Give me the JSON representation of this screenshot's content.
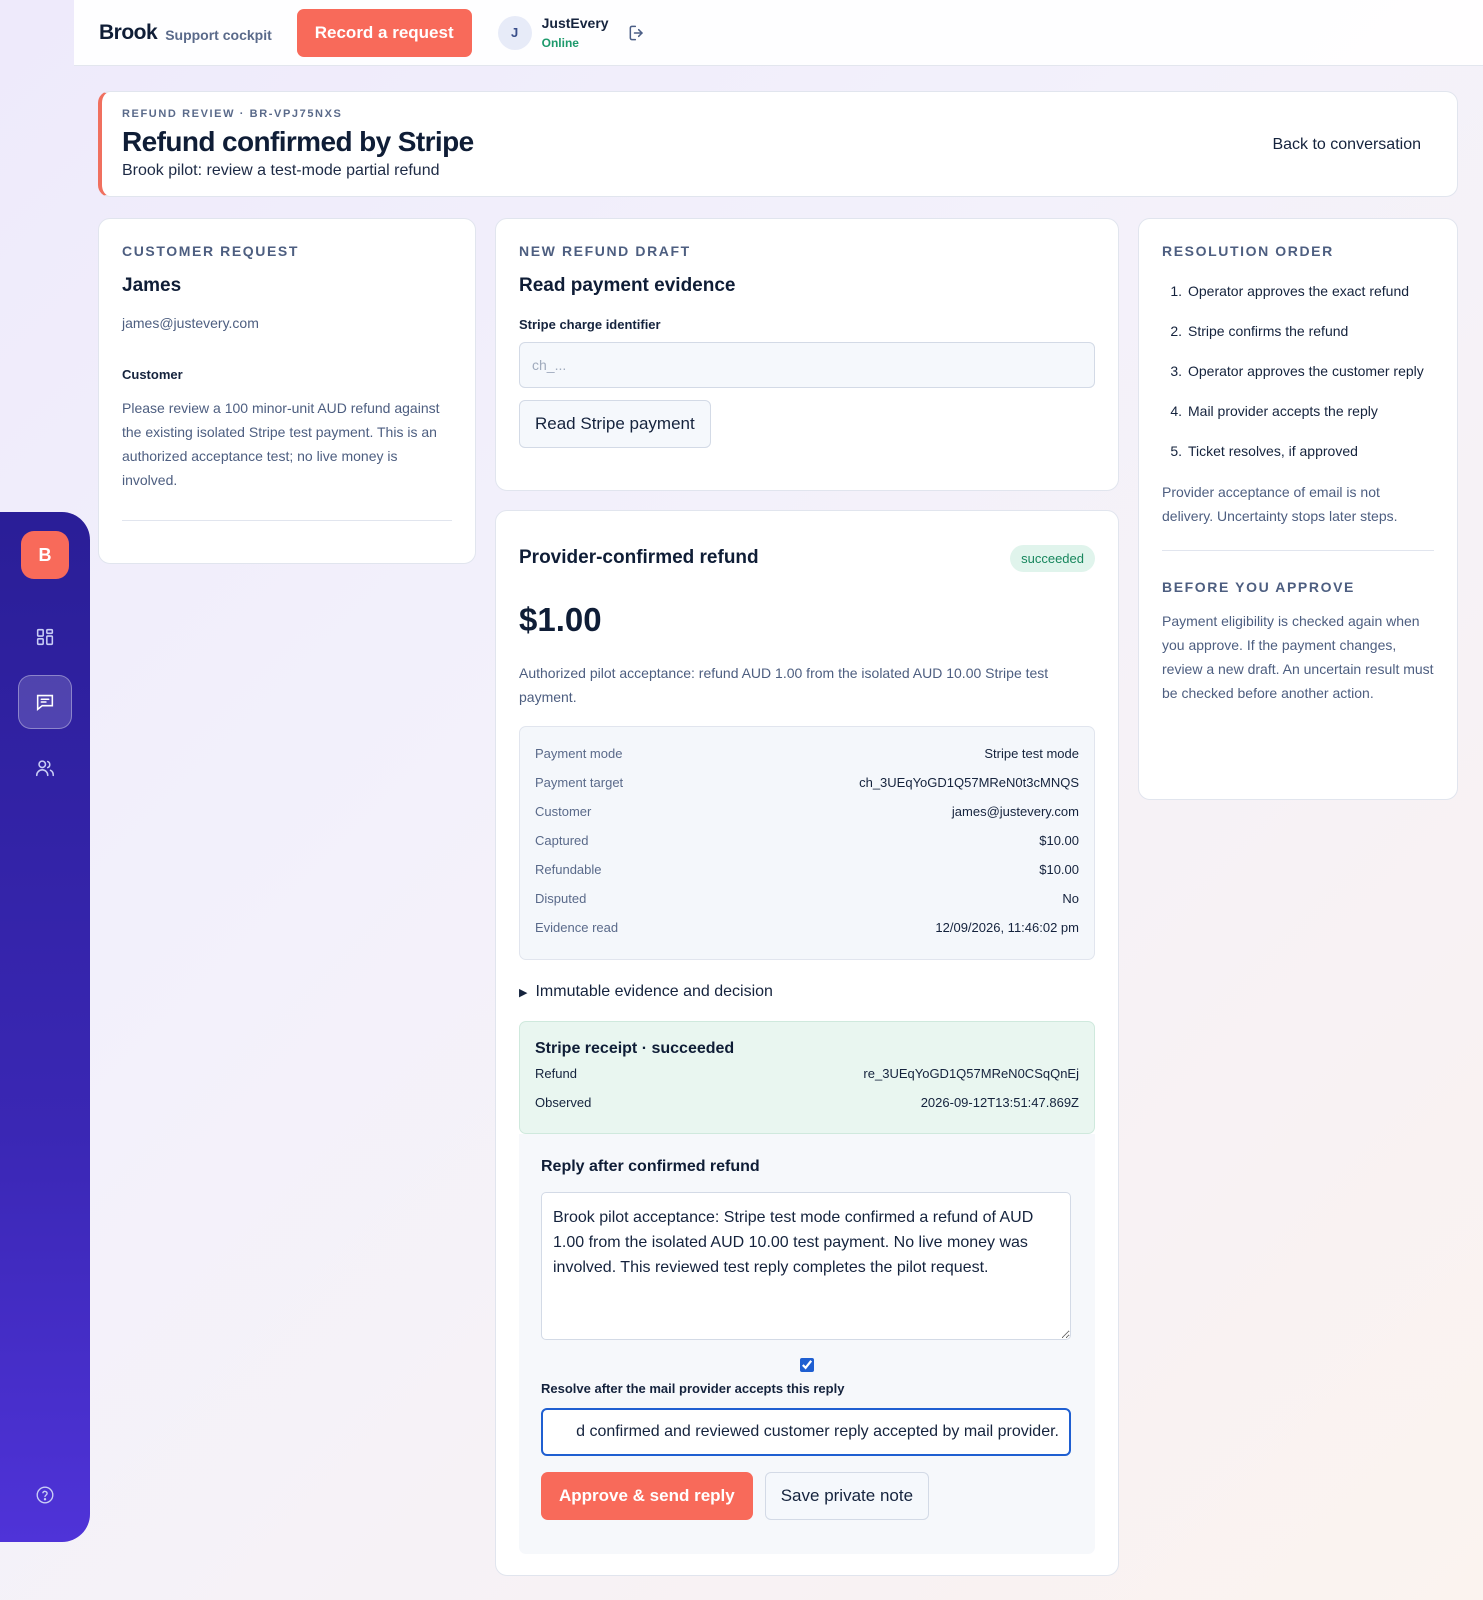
{
  "topbar": {
    "brand": "Brook",
    "brand_sub": "Support cockpit",
    "record_button": "Record a request",
    "user_initial": "J",
    "user_name": "JustEvery",
    "user_status": "Online"
  },
  "rail": {
    "logo_letter": "B",
    "items": [
      "dashboard-icon",
      "conversations-icon",
      "customers-icon",
      "help-icon"
    ],
    "active": "conversations-icon"
  },
  "header": {
    "eyebrow": "REFUND REVIEW · BR-VPJ75NXS",
    "title": "Refund confirmed by Stripe",
    "subtitle": "Brook pilot: review a test-mode partial refund",
    "back_link": "Back to conversation"
  },
  "customer_request": {
    "label": "CUSTOMER REQUEST",
    "name": "James",
    "email": "james@justevery.com",
    "role": "Customer",
    "message": "Please review a 100 minor-unit AUD refund against the existing isolated Stripe test payment. This is an authorized acceptance test; no live money is involved."
  },
  "draft": {
    "label": "NEW REFUND DRAFT",
    "title": "Read payment evidence",
    "field_label": "Stripe charge identifier",
    "placeholder": "ch_...",
    "button": "Read Stripe payment"
  },
  "refund": {
    "title": "Provider-confirmed refund",
    "status": "succeeded",
    "amount": "$1.00",
    "note": "Authorized pilot acceptance: refund AUD 1.00 from the isolated AUD 10.00 Stripe test payment.",
    "evidence": [
      {
        "key": "Payment mode",
        "value": "Stripe test mode"
      },
      {
        "key": "Payment target",
        "value": "ch_3UEqYoGD1Q57MReN0t3cMNQS"
      },
      {
        "key": "Customer",
        "value": "james@justevery.com"
      },
      {
        "key": "Captured",
        "value": "$10.00"
      },
      {
        "key": "Refundable",
        "value": "$10.00"
      },
      {
        "key": "Disputed",
        "value": "No"
      },
      {
        "key": "Evidence read",
        "value": "12/09/2026, 11:46:02 pm"
      }
    ],
    "disclosure": "Immutable evidence and decision",
    "receipt": {
      "title": "Stripe receipt · succeeded",
      "rows": [
        {
          "key": "Refund",
          "value": "re_3UEqYoGD1Q57MReN0CSqQnEj"
        },
        {
          "key": "Observed",
          "value": "2026-09-12T13:51:47.869Z"
        }
      ]
    }
  },
  "reply": {
    "title": "Reply after confirmed refund",
    "body": "Brook pilot acceptance: Stripe test mode confirmed a refund of AUD 1.00 from the isolated AUD 10.00 test payment. No live money was involved. This reviewed test reply completes the pilot request.",
    "resolve_checked": true,
    "resolve_label": "Resolve after the mail provider accepts this reply",
    "resolve_value": "d confirmed and reviewed customer reply accepted by mail provider.",
    "approve_button": "Approve & send reply",
    "note_button": "Save private note"
  },
  "resolution": {
    "label": "RESOLUTION ORDER",
    "steps": [
      "Operator approves the exact refund",
      "Stripe confirms the refund",
      "Operator approves the customer reply",
      "Mail provider accepts the reply",
      "Ticket resolves, if approved"
    ],
    "note": "Provider acceptance of email is not delivery. Uncertainty stops later steps.",
    "approve_label": "BEFORE YOU APPROVE",
    "approve_note": "Payment eligibility is checked again when you approve. If the payment changes, review a new draft. An uncertain result must be checked before another action."
  },
  "colors": {
    "accent": "#f86a5a",
    "rail": "#3a27b4",
    "success": "#17865d",
    "focus": "#1f5fd1"
  }
}
